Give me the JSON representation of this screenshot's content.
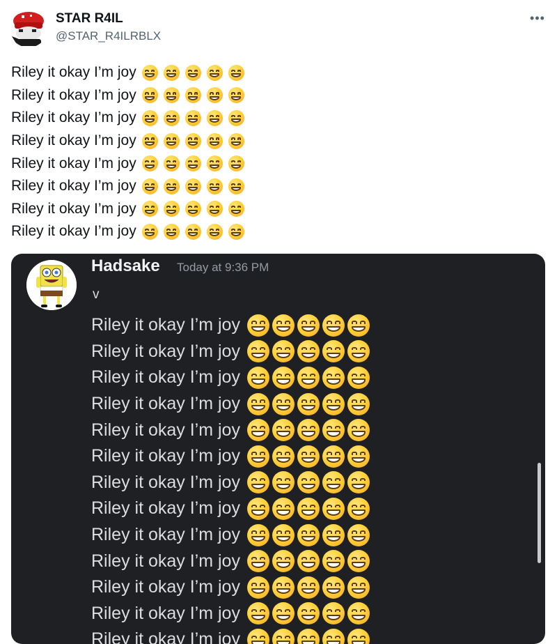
{
  "tweet": {
    "author_name": "STAR R4IL",
    "author_handle": "@STAR_R4ILRBLX",
    "more_icon": "•••",
    "lines": [
      "Riley it okay I’m joy",
      "Riley it okay I’m joy",
      "Riley it okay I’m joy",
      "Riley it okay I’m joy",
      "Riley it okay I’m joy",
      "Riley it okay I’m joy",
      "Riley it okay I’m joy",
      "Riley it okay I’m joy"
    ],
    "emoji_per_line": 5,
    "emoji_name": "grinning-face-with-smiling-eyes-icon"
  },
  "discord": {
    "username": "Hadsake",
    "timestamp": "Today at 9:36 PM",
    "first_line": "v",
    "lines": [
      "Riley it okay I’m joy",
      "Riley it okay I’m joy",
      "Riley it okay I’m joy",
      "Riley it okay I’m joy",
      "Riley it okay I’m joy",
      "Riley it okay I’m joy",
      "Riley it okay I’m joy",
      "Riley it okay I’m joy",
      "Riley it okay I’m joy",
      "Riley it okay I’m joy",
      "Riley it okay I’m joy",
      "Riley it okay I’m joy",
      "Riley it okay I’m joy"
    ],
    "emoji_per_line": 5,
    "background_color": "#1f2024"
  },
  "colors": {
    "tweet_text": "#0f1419",
    "handle": "#536471",
    "discord_text": "#dbdee1",
    "discord_muted": "#949ba4",
    "emoji": "#ffd23a"
  }
}
